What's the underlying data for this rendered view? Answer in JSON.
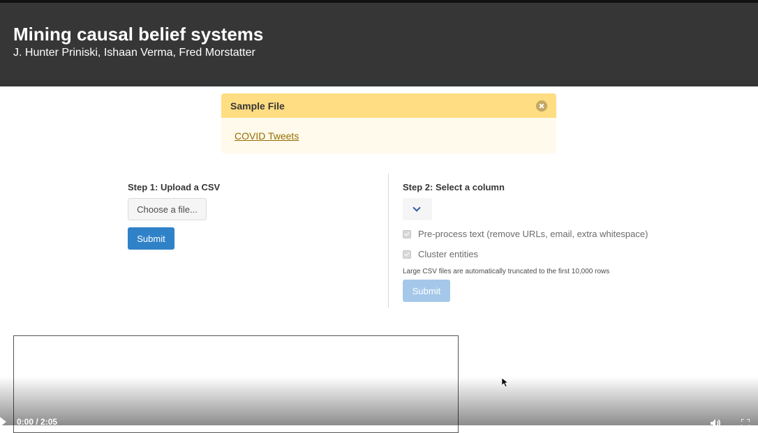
{
  "header": {
    "title": "Mining causal belief systems",
    "authors": "J. Hunter Priniski, Ishaan Verma, Fred Morstatter"
  },
  "sample_message": {
    "title": "Sample File",
    "link_text": "COVID Tweets",
    "close_icon": "close-icon"
  },
  "step1": {
    "label": "Step 1: Upload a CSV",
    "file_button": "Choose a file...",
    "submit": "Submit"
  },
  "step2": {
    "label": "Step 2: Select a column",
    "select_value": "",
    "options": [
      {
        "label": "Pre-process text (remove URLs, email, extra whitespace)",
        "checked": true,
        "disabled": true
      },
      {
        "label": "Cluster entities",
        "checked": true,
        "disabled": true
      }
    ],
    "help": "Large CSV files are automatically truncated to the first 10,000 rows",
    "submit": "Submit",
    "submit_disabled": true
  },
  "video": {
    "time": "0:00 / 2:05",
    "controls": [
      "play-icon",
      "volume-icon",
      "fullscreen-icon"
    ]
  },
  "colors": {
    "hero": "#363636",
    "warning_header": "#ffdd82",
    "warning_body": "#fffaeb",
    "primary": "#3082c8",
    "primary_disabled": "#a5c8ea"
  }
}
